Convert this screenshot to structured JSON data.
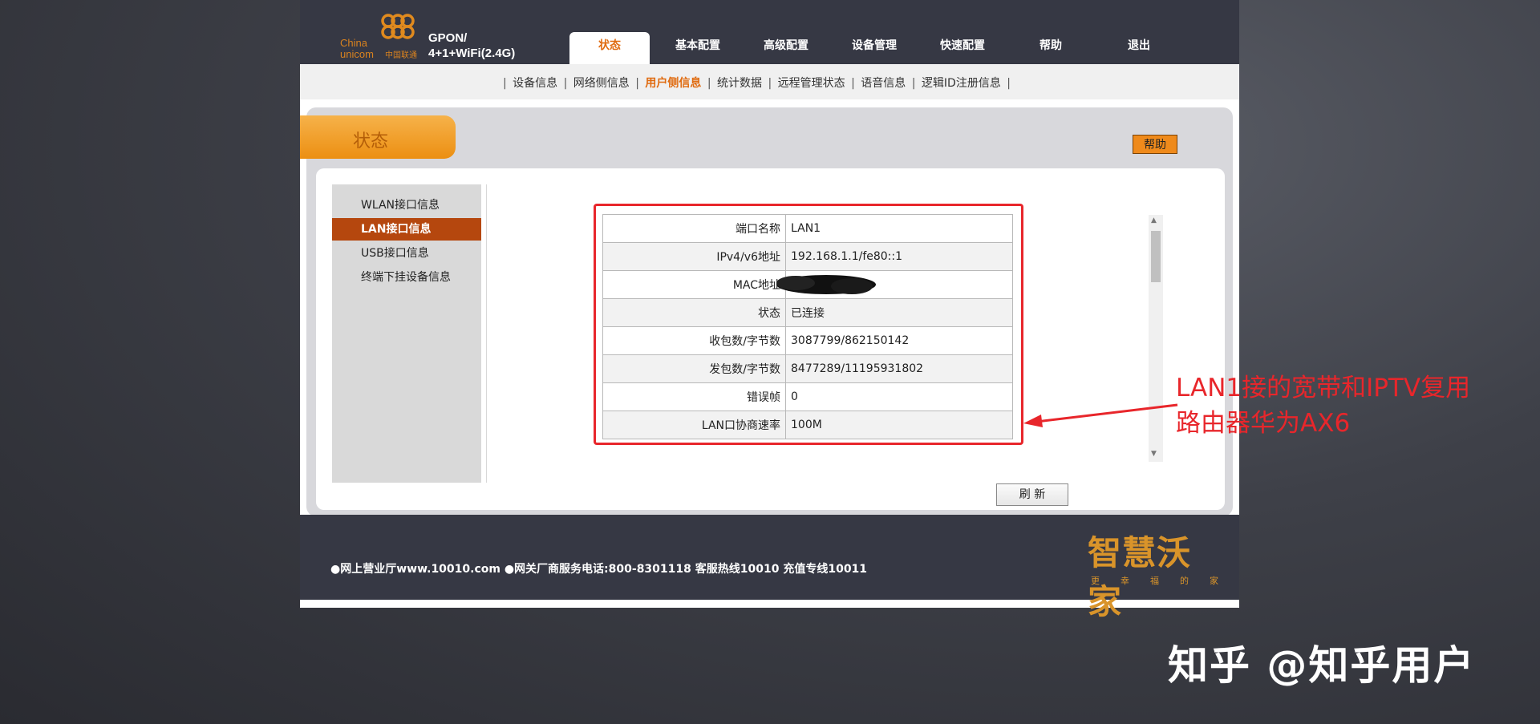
{
  "header": {
    "logo_text_1": "China",
    "logo_text_2": "unicom",
    "logo_text_3": "中国联通",
    "model_line_1": "GPON/",
    "model_line_2": "4+1+WiFi(2.4G)",
    "nav": [
      "状态",
      "基本配置",
      "高级配置",
      "设备管理",
      "快速配置",
      "帮助",
      "退出"
    ],
    "active_nav": "状态"
  },
  "subnav": {
    "items": [
      "设备信息",
      "网络侧信息",
      "用户侧信息",
      "统计数据",
      "远程管理状态",
      "语音信息",
      "逻辑ID注册信息"
    ],
    "active": "用户侧信息"
  },
  "section": {
    "title": "状态",
    "help_label": "帮助"
  },
  "sidebar": {
    "items": [
      "WLAN接口信息",
      "LAN接口信息",
      "USB接口信息",
      "终端下挂设备信息"
    ],
    "active": "LAN接口信息"
  },
  "table": {
    "rows": [
      {
        "label": "端口名称",
        "value": "LAN1"
      },
      {
        "label": "IPv4/v6地址",
        "value": "192.168.1.1/fe80::1"
      },
      {
        "label": "MAC地址",
        "value": ""
      },
      {
        "label": "状态",
        "value": "已连接"
      },
      {
        "label": "收包数/字节数",
        "value": "3087799/862150142"
      },
      {
        "label": "发包数/字节数",
        "value": "8477289/11195931802"
      },
      {
        "label": "错误帧",
        "value": "0"
      },
      {
        "label": "LAN口协商速率",
        "value": "100M"
      }
    ]
  },
  "refresh_label": "刷 新",
  "footer": {
    "text": "●网上营业厅www.10010.com ●网关厂商服务电话:800-8301118 客服热线10010 充值专线10011",
    "brand": "智慧沃家",
    "brand_slogan": "更幸福的家"
  },
  "annotation": {
    "line_1": "LAN1接的宽带和IPTV复用",
    "line_2": "路由器华为AX6",
    "color": "#e8262b"
  },
  "watermark": "知乎 @知乎用户",
  "colors": {
    "header_bg": "#363844",
    "accent_orange": "#ef8a1b",
    "sidebar_active": "#b5470e",
    "subnav_active": "#e06b10"
  }
}
